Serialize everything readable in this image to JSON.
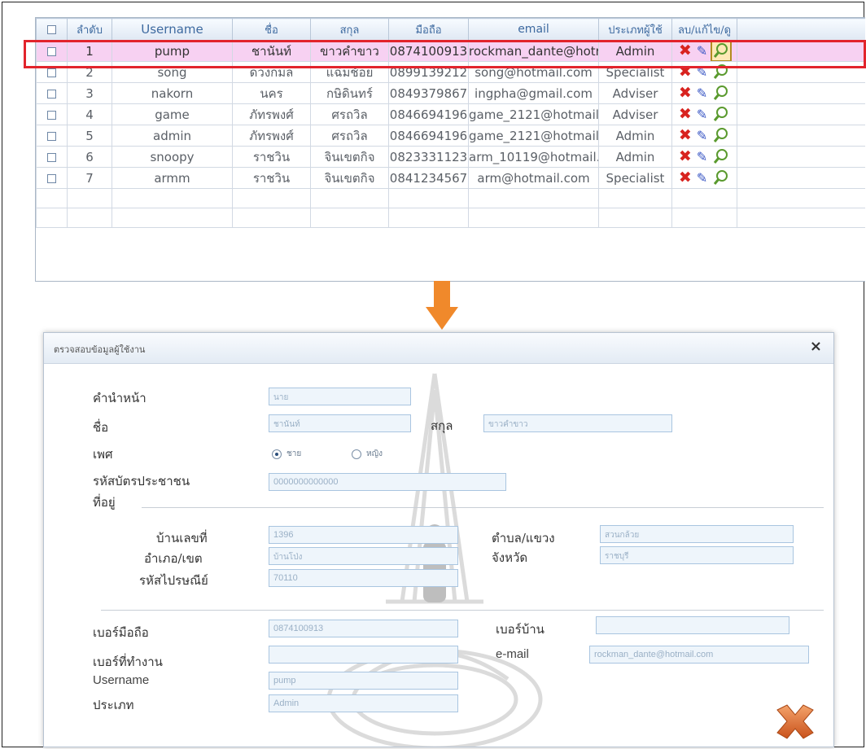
{
  "grid": {
    "headers": {
      "select": "",
      "no": "ลำดับ",
      "username": "Username",
      "name": "ชื่อ",
      "surname": "สกุล",
      "mobile": "มือถือ",
      "email": "email",
      "type": "ประเภทผู้ใช้",
      "actions": "ลบ/แก้ไข/ดู"
    },
    "rows": [
      {
        "no": "1",
        "username": "pump",
        "name": "ชานันท์",
        "surname": "ขาวคำขาว",
        "mobile": "0874100913",
        "email": "rockman_dante@hotr",
        "type": "Admin"
      },
      {
        "no": "2",
        "username": "song",
        "name": "ดวงกมล",
        "surname": "แฉ่มช้อย",
        "mobile": "0899139212",
        "email": "song@hotmail.com",
        "type": "Specialist"
      },
      {
        "no": "3",
        "username": "nakorn",
        "name": "นคร",
        "surname": "กษิดินทร์",
        "mobile": "0849379867",
        "email": "ingpha@gmail.com",
        "type": "Adviser"
      },
      {
        "no": "4",
        "username": "game",
        "name": "ภัทรพงศ์",
        "surname": "ศรถวิล",
        "mobile": "0846694196",
        "email": "game_2121@hotmail",
        "type": "Adviser"
      },
      {
        "no": "5",
        "username": "admin",
        "name": "ภัทรพงศ์",
        "surname": "ศรถวิล",
        "mobile": "0846694196",
        "email": "game_2121@hotmail",
        "type": "Admin"
      },
      {
        "no": "6",
        "username": "snoopy",
        "name": "ราชวิน",
        "surname": "จินเขตกิจ",
        "mobile": "0823331123",
        "email": "arm_10119@hotmail.",
        "type": "Admin"
      },
      {
        "no": "7",
        "username": "armm",
        "name": "ราชวิน",
        "surname": "จินเขตกิจ",
        "mobile": "0841234567",
        "email": "arm@hotmail.com",
        "type": "Specialist"
      }
    ]
  },
  "dialog": {
    "title": "ตรวจสอบข้อมูลผู้ใช้งาน",
    "close_icon": "×",
    "labels": {
      "prefix": "คำนำหน้า",
      "name": "ชื่อ",
      "surname": "สกุล",
      "gender": "เพศ",
      "id_card": "รหัสบัตรประชาชน",
      "address": "ที่อยู่",
      "house_no": "บ้านเลขที่",
      "district": "อำเภอ/เขต",
      "postcode": "รหัสไปรษณีย์",
      "subdistrict": "ตำบล/แขวง",
      "province": "จังหวัด",
      "mobile": "เบอร์มือถือ",
      "home_phone": "เบอร์บ้าน",
      "work_phone": "เบอร์ที่ทำงาน",
      "email": "e-mail",
      "username": "Username",
      "type": "ประเภท"
    },
    "values": {
      "prefix": "นาย",
      "name": "ชานันท์",
      "surname": "ขาวคำขาว",
      "gender_male": "ชาย",
      "gender_female": "หญิง",
      "id_card": "0000000000000",
      "house_no": "1396",
      "district": "บ้านโป่ง",
      "postcode": "70110",
      "subdistrict": "สวนกล้วย",
      "province": "ราชบุรี",
      "mobile": "0874100913",
      "home_phone": "",
      "work_phone": "",
      "email": "rockman_dante@hotmail.com",
      "username": "pump",
      "type": "Admin"
    }
  },
  "colors": {
    "highlight_border": "#e2242c",
    "selected_row": "#f7d1f2",
    "arrow": "#f0892b",
    "delete_icon": "#d8231f"
  }
}
